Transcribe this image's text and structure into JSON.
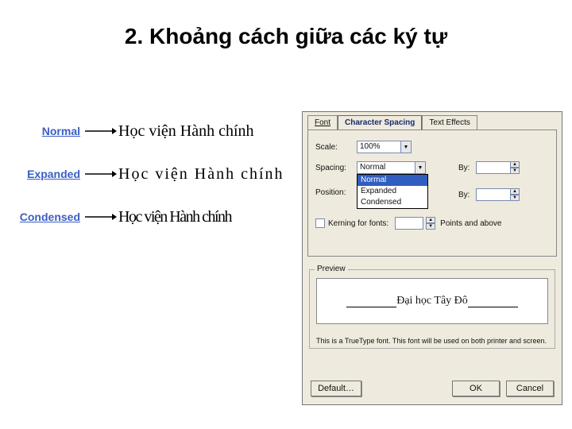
{
  "title": "2. Khoảng cách giữa các ký tự",
  "examples": {
    "normal_label": "Normal",
    "expanded_label": "Expanded",
    "condensed_label": "Condensed",
    "sample_text": "Học viện Hành chính"
  },
  "dialog": {
    "tabs": {
      "font": "Font",
      "char_spacing": "Character Spacing",
      "text_effects": "Text Effects"
    },
    "scale": {
      "label": "Scale:",
      "value": "100%"
    },
    "spacing": {
      "label": "Spacing:",
      "value": "Normal",
      "options": [
        "Normal",
        "Expanded",
        "Condensed"
      ],
      "by_label": "By:",
      "by_value": ""
    },
    "position": {
      "label": "Position:",
      "by_label": "By:",
      "by_value": ""
    },
    "kerning": {
      "label": "Kerning for fonts:",
      "after": "Points and above"
    },
    "preview": {
      "legend": "Preview",
      "text": "Đại học Tây Đô",
      "note": "This is a TrueType font. This font will be used on both printer and screen."
    },
    "buttons": {
      "default": "Default…",
      "ok": "OK",
      "cancel": "Cancel"
    }
  }
}
